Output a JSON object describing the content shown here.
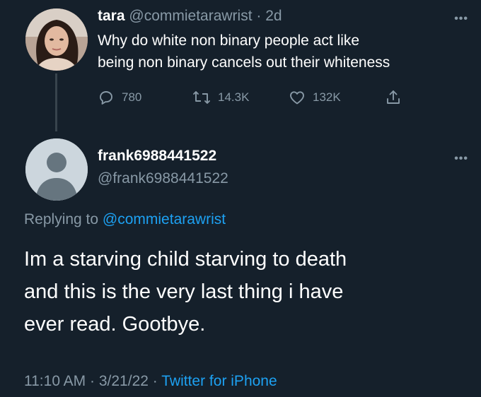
{
  "tweet1": {
    "display_name": "tara",
    "handle": "@commietarawrist",
    "separator": "·",
    "age": "2d",
    "text_lines": [
      "Why do white non binary people act like",
      "being non binary cancels out their whiteness"
    ],
    "more_icon": "more-dots-icon",
    "actions": {
      "reply_count": "780",
      "retweet_count": "14.3K",
      "like_count": "132K"
    }
  },
  "tweet2": {
    "display_name": "frank6988441522",
    "handle": "@frank6988441522",
    "more_icon": "more-dots-icon",
    "replying_prefix": "Replying to",
    "replying_handle": "@commietarawrist",
    "text_lines": [
      "Im a starving child starving to death",
      "and this is the very last thing i have",
      "ever read. Gootbye."
    ],
    "time": "11:10 AM",
    "date": "3/21/22",
    "separator": "·",
    "source": "Twitter for iPhone"
  },
  "colors": {
    "background": "#15202b",
    "primary_text": "#ffffff",
    "secondary_text": "#8899a6",
    "link": "#1da1f2",
    "thread_line": "#38444d"
  }
}
